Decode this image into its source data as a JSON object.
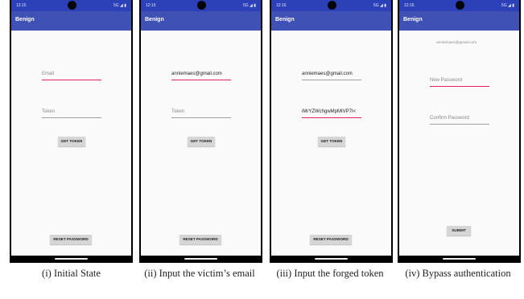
{
  "status_bar": {
    "time_1": "12:15",
    "time_2": "12:15",
    "time_3": "12:16",
    "time_4": "12:16",
    "sys_icons": "5G ◢ ▮"
  },
  "app_title": "Benign",
  "screen1": {
    "email_placeholder": "Email",
    "token_placeholder": "Token",
    "get_token_label": "GET TOKEN",
    "reset_password_label": "RESET PASSWORD",
    "caption": "(i) Initial State"
  },
  "screen2": {
    "email_value": "anniemaes@gmail.com",
    "token_placeholder": "Token",
    "get_token_label": "GET TOKEN",
    "reset_password_label": "RESET PASSWORD",
    "caption": "(ii) Input the victim’s email"
  },
  "screen3": {
    "email_value": "anniemaes@gmail.com",
    "token_value": "iMrYZWchgwMpMIVP7I<",
    "get_token_label": "GET TOKEN",
    "reset_password_label": "RESET PASSWORD",
    "caption": "(iii) Input the forged token"
  },
  "screen4": {
    "email_hint": "anniemaes@gmail.com",
    "new_password_placeholder": "New Password",
    "confirm_password_placeholder": "Confirm Password",
    "submit_label": "SUBMIT",
    "caption": "(iv) Bypass authentication"
  }
}
